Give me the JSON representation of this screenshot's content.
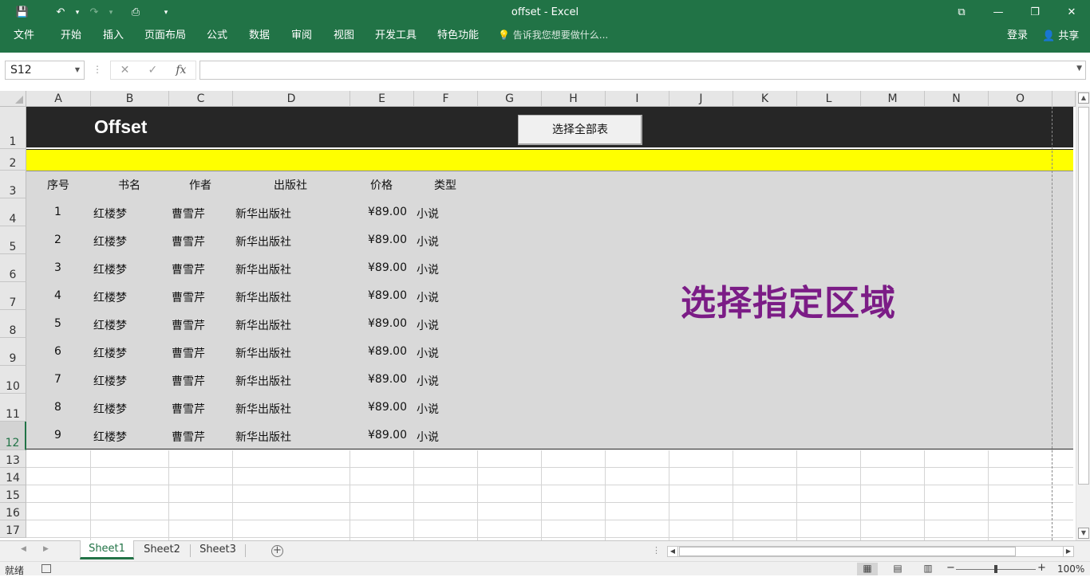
{
  "window": {
    "title": "offset - Excel",
    "qat": {
      "save_icon": "💾",
      "undo_icon": "↶",
      "redo_icon": "↷",
      "preview_icon": "⎙",
      "more_icon": "▾"
    },
    "controls": {
      "ribbon_display": "⧉",
      "minimize": "—",
      "restore": "❐",
      "close": "✕"
    }
  },
  "ribbon": {
    "tabs": [
      "文件",
      "开始",
      "插入",
      "页面布局",
      "公式",
      "数据",
      "审阅",
      "视图",
      "开发工具",
      "特色功能"
    ],
    "tell_me": "告诉我您想要做什么...",
    "login": "登录",
    "share": "共享"
  },
  "formula_bar": {
    "name_box": "S12",
    "cancel": "✕",
    "enter": "✓",
    "fx": "fx",
    "formula": ""
  },
  "columns": [
    "A",
    "B",
    "C",
    "D",
    "E",
    "F",
    "G",
    "H",
    "I",
    "J",
    "K",
    "L",
    "M",
    "N",
    "O"
  ],
  "rows": [
    "1",
    "2",
    "3",
    "4",
    "5",
    "6",
    "7",
    "8",
    "9",
    "10",
    "11",
    "12",
    "13",
    "14",
    "15",
    "16",
    "17"
  ],
  "sheet": {
    "title": "Offset",
    "select_all_button": "选择全部表",
    "headers": [
      "序号",
      "书名",
      "作者",
      "出版社",
      "价格",
      "类型"
    ],
    "records": [
      [
        "1",
        "红楼梦",
        "曹雪芹",
        "新华出版社",
        "¥89.00",
        "小说"
      ],
      [
        "2",
        "红楼梦",
        "曹雪芹",
        "新华出版社",
        "¥89.00",
        "小说"
      ],
      [
        "3",
        "红楼梦",
        "曹雪芹",
        "新华出版社",
        "¥89.00",
        "小说"
      ],
      [
        "4",
        "红楼梦",
        "曹雪芹",
        "新华出版社",
        "¥89.00",
        "小说"
      ],
      [
        "5",
        "红楼梦",
        "曹雪芹",
        "新华出版社",
        "¥89.00",
        "小说"
      ],
      [
        "6",
        "红楼梦",
        "曹雪芹",
        "新华出版社",
        "¥89.00",
        "小说"
      ],
      [
        "7",
        "红楼梦",
        "曹雪芹",
        "新华出版社",
        "¥89.00",
        "小说"
      ],
      [
        "8",
        "红楼梦",
        "曹雪芹",
        "新华出版社",
        "¥89.00",
        "小说"
      ],
      [
        "9",
        "红楼梦",
        "曹雪芹",
        "新华出版社",
        "¥89.00",
        "小说"
      ]
    ],
    "highlight_text": "选择指定区域"
  },
  "sheet_tabs": [
    "Sheet1",
    "Sheet2",
    "Sheet3"
  ],
  "status": {
    "ready": "就绪",
    "zoom": "100%"
  },
  "colors": {
    "excel_green": "#217346",
    "title_band": "#262626",
    "yellow": "#ffff00",
    "body_gray": "#d9d9d9",
    "highlight": "#7b1c86"
  }
}
